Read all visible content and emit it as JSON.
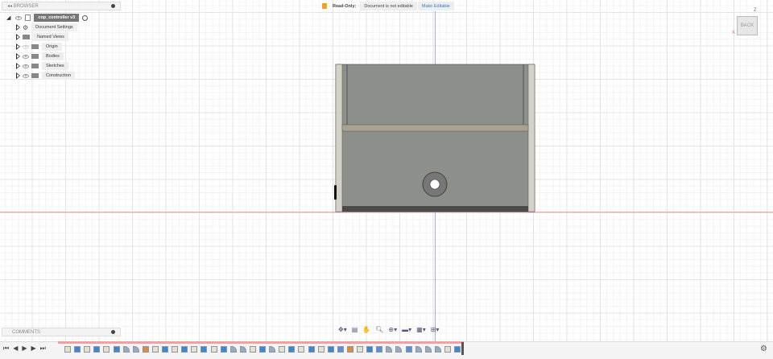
{
  "browser": {
    "title": "BROWSER",
    "root": "cop_controller v3",
    "items": [
      {
        "label": "Document Settings",
        "icon": "gear-icon"
      },
      {
        "label": "Named Views",
        "icon": "folder-icon"
      },
      {
        "label": "Origin",
        "icon": "folder-icon",
        "eye": "dim"
      },
      {
        "label": "Bodies",
        "icon": "folder-icon",
        "eye": "on"
      },
      {
        "label": "Sketches",
        "icon": "folder-icon",
        "eye": "on"
      },
      {
        "label": "Construction",
        "icon": "folder-icon",
        "eye": "on"
      }
    ]
  },
  "banner": {
    "status": "Read-Only:",
    "message": "Document is not editable",
    "action": "Make Editable"
  },
  "viewcube": {
    "face": "BACK",
    "axis_x": "X",
    "axis_z": "Z"
  },
  "comments": {
    "title": "COMMENTS"
  },
  "colors": {
    "accent": "#2b7fd1",
    "x_axis": "#f0a0a0",
    "z_axis": "#a9a9f0"
  },
  "timeline": {
    "features": [
      "sketch",
      "extrude",
      "sketch",
      "extrude",
      "sketch",
      "extrude",
      "fillet",
      "fillet",
      "joint",
      "sketch",
      "extrude",
      "sketch",
      "extrude",
      "sketch",
      "extrude",
      "sketch",
      "extrude",
      "fillet",
      "fillet",
      "sketch",
      "extrude",
      "fillet",
      "sketch",
      "extrude",
      "sketch",
      "extrude",
      "sketch",
      "extrude",
      "chamfer",
      "joint",
      "sketch",
      "extrude",
      "chamfer",
      "fillet",
      "fillet",
      "chamfer",
      "fillet",
      "fillet",
      "fillet",
      "sketch",
      "extrude"
    ]
  }
}
